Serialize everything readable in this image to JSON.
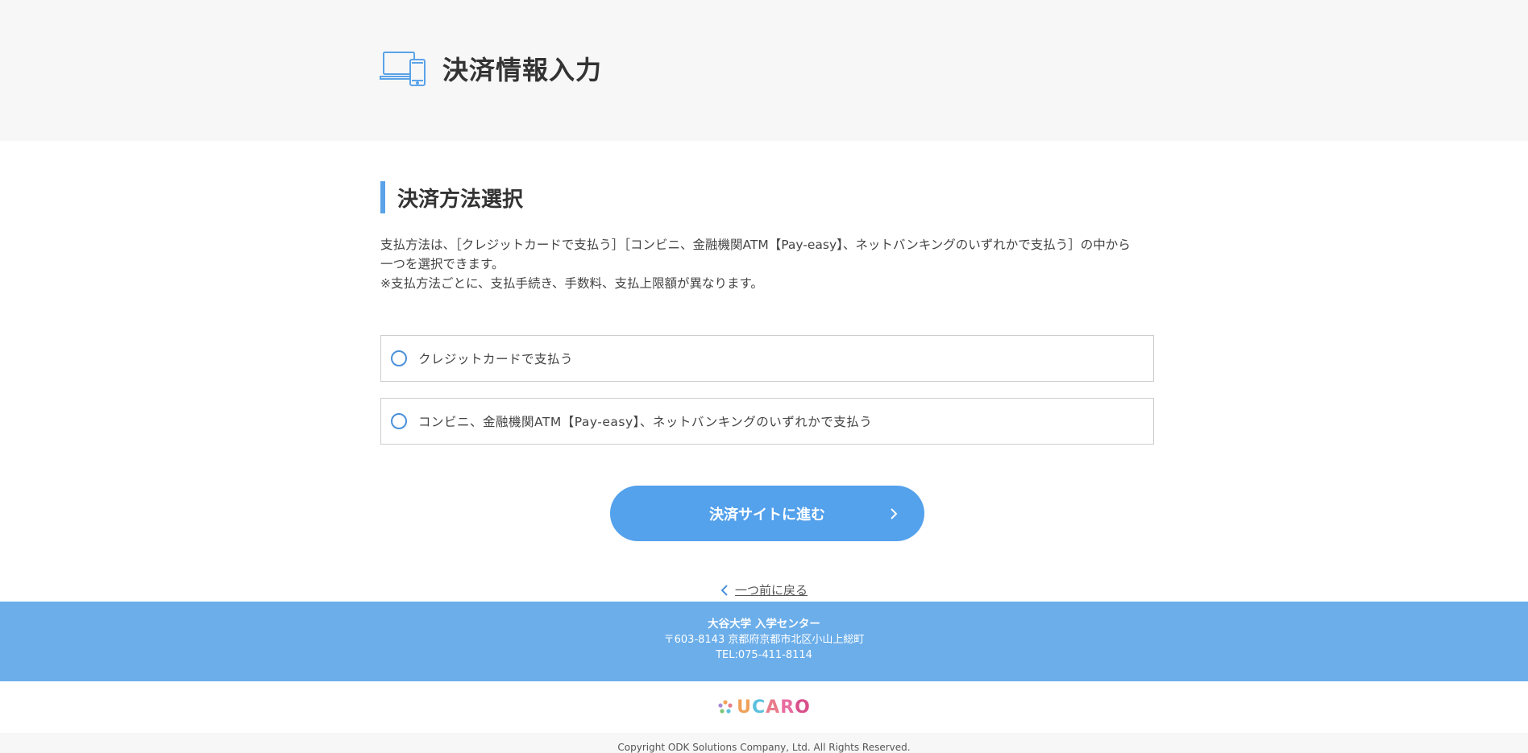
{
  "header": {
    "title": "決済情報入力",
    "icon": "devices-icon",
    "icon_color": "#5ba3e8"
  },
  "section": {
    "heading": "決済方法選択",
    "accent_color": "#5ba3e8",
    "description_line1": "支払方法は、［クレジットカードで支払う］［コンビニ、金融機関ATM【Pay-easy】、ネットバンキングのいずれかで支払う］の中から",
    "description_line2": "一つを選択できます。",
    "description_line3": "※支払方法ごとに、支払手続き、手数料、支払上限額が異なります。"
  },
  "options": [
    {
      "label": "クレジットカードで支払う",
      "selected": false
    },
    {
      "label": "コンビニ、金融機関ATM【Pay-easy】、ネットバンキングのいずれかで支払う",
      "selected": false
    }
  ],
  "actions": {
    "submit_label": "決済サイトに進む",
    "submit_color": "#54a1ec",
    "back_label": "一つ前に戻る"
  },
  "footer": {
    "org": "大谷大学 入学センター",
    "address": "〒603-8143 京都府京都市北区小山上総町",
    "tel": "TEL:075-411-8114",
    "band_color": "#6baeea"
  },
  "logo": {
    "letters": [
      "U",
      "C",
      "A",
      "R",
      "O"
    ],
    "colors": [
      "#f0a15a",
      "#5bc0de",
      "#e87c8a",
      "#e86ba0",
      "#d94f8a"
    ]
  },
  "copyright": "Copyright ODK Solutions Company, Ltd. All Rights Reserved."
}
